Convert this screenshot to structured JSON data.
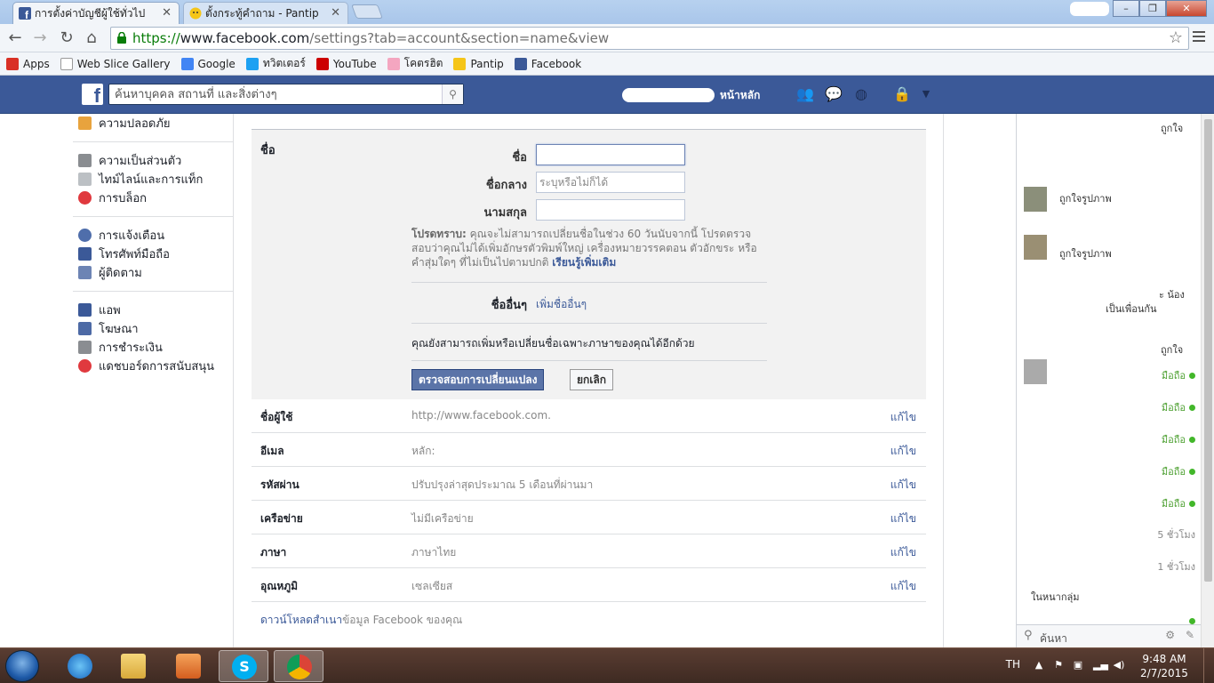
{
  "browser": {
    "tabs": [
      {
        "title": "การตั้งค่าบัญชีผู้ใช้ทั่วไป",
        "active": true
      },
      {
        "title": "ตั้งกระทู้คำถาม - Pantip",
        "active": false
      }
    ],
    "url": {
      "scheme": "https://",
      "host": "www.facebook.com",
      "path": "/settings?tab=account&section=name&view"
    },
    "bookmarks": [
      {
        "label": "Apps",
        "icon": "apps-grid-icon",
        "color": "#d93025"
      },
      {
        "label": "Web Slice Gallery",
        "icon": "page-icon",
        "color": "#ffffff"
      },
      {
        "label": "Google",
        "icon": "google-icon",
        "color": "#4285f4"
      },
      {
        "label": "ทวิตเตอร์",
        "icon": "twitter-icon",
        "color": "#1da1f2"
      },
      {
        "label": "YouTube",
        "icon": "youtube-icon",
        "color": "#cc0000"
      },
      {
        "label": "โคตรฮิต",
        "icon": "heart-icon",
        "color": "#f4a6c0"
      },
      {
        "label": "Pantip",
        "icon": "pantip-icon",
        "color": "#f5c518"
      },
      {
        "label": "Facebook",
        "icon": "facebook-icon",
        "color": "#3b5998"
      }
    ]
  },
  "header": {
    "search_placeholder": "ค้นหาบุคคล สถานที่ และสิ่งต่างๆ",
    "home_label": "หน้าหลัก"
  },
  "sidebar": {
    "groups": [
      [
        {
          "label": "ความปลอดภัย",
          "icon": "security-badge-icon",
          "color": "#e8a33d"
        }
      ],
      [
        {
          "label": "ความเป็นส่วนตัว",
          "icon": "privacy-lock-icon",
          "color": "#8a8d91"
        },
        {
          "label": "ไทม์ไลน์และการแท็ก",
          "icon": "timeline-icon",
          "color": "#bcc0c4"
        },
        {
          "label": "การบล็อก",
          "icon": "block-icon",
          "color": "#e0393e"
        }
      ],
      [
        {
          "label": "การแจ้งเตือน",
          "icon": "globe-notifications-icon",
          "color": "#4f6eab"
        },
        {
          "label": "โทรศัพท์มือถือ",
          "icon": "mobile-phone-icon",
          "color": "#3b5998"
        },
        {
          "label": "ผู้ติดตาม",
          "icon": "rss-icon",
          "color": "#6d84b4"
        }
      ],
      [
        {
          "label": "แอพ",
          "icon": "apps-icon",
          "color": "#3b5998"
        },
        {
          "label": "โฆษณา",
          "icon": "ads-icon",
          "color": "#4d6aa5"
        },
        {
          "label": "การชำระเงิน",
          "icon": "payments-card-icon",
          "color": "#8a8d91"
        },
        {
          "label": "แดชบอร์ดการสนับสนุน",
          "icon": "support-lifebuoy-icon",
          "color": "#e0393e"
        }
      ]
    ]
  },
  "name_edit": {
    "section_title": "ชื่อ",
    "first_name_label": "ชื่อ",
    "first_name_value": "",
    "middle_name_label": "ชื่อกลาง",
    "middle_name_placeholder": "ระบุหรือไม่ก็ได้",
    "last_name_label": "นามสกุล",
    "last_name_value": "",
    "notice_bold": "โปรดทราบ:",
    "notice_text": " คุณจะไม่สามารถเปลี่ยนชื่อในช่วง 60 วันนับจากนี้ โปรดตรวจสอบว่าคุณไม่ได้เพิ่มอักษรตัวพิมพ์ใหญ่ เครื่องหมายวรรคตอน ตัวอักขระ หรือคำสุ่มใดๆ ที่ไม่เป็นไปตามปกติ ",
    "learn_more": "เรียนรู้เพิ่มเติม",
    "other_names_label": "ชื่ออื่นๆ",
    "other_names_link": "เพิ่มชื่ออื่นๆ",
    "language_note": "คุณยังสามารถเพิ่มหรือเปลี่ยนชื่อเฉพาะภาษาของคุณได้อีกด้วย",
    "review_button": "ตรวจสอบการเปลี่ยนแปลง",
    "cancel_button": "ยกเลิก"
  },
  "settings_rows": [
    {
      "key": "ชื่อผู้ใช้",
      "value": "http://www.facebook.com.",
      "edit": "แก้ไข"
    },
    {
      "key": "อีเมล",
      "value": "หลัก:",
      "edit": "แก้ไข"
    },
    {
      "key": "รหัสผ่าน",
      "value": "ปรับปรุงล่าสุดประมาณ 5 เดือนที่ผ่านมา",
      "edit": "แก้ไข"
    },
    {
      "key": "เครือข่าย",
      "value": "ไม่มีเครือข่าย",
      "edit": "แก้ไข"
    },
    {
      "key": "ภาษา",
      "value": "ภาษาไทย",
      "edit": "แก้ไข"
    },
    {
      "key": "อุณหภูมิ",
      "value": "เซลเซียส",
      "edit": "แก้ไข"
    }
  ],
  "download": {
    "link": "ดาวน์โหลดสำเนา",
    "rest": "ข้อมูล Facebook ของคุณ"
  },
  "chat": {
    "snippets": [
      "ถูกใจ",
      "ถูกใจรูปภาพ",
      "ะ น้อง",
      "เป็นเพื่อนกัน",
      "ถูกใจ",
      "ในหนากลุ่ม"
    ],
    "status_mobile": "มือถือ",
    "time_1": "5 ชั่วโมง",
    "time_2": "1 ชั่วโมง",
    "search_placeholder": "ค้นหา"
  },
  "taskbar": {
    "language": "TH",
    "time": "9:48 AM",
    "date": "2/7/2015"
  }
}
